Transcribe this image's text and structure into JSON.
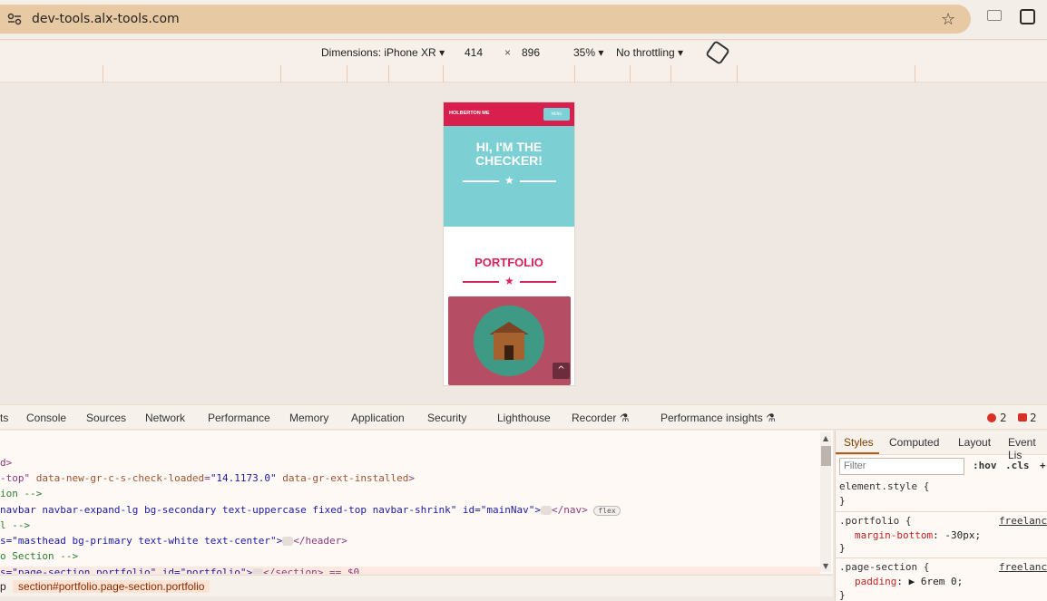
{
  "browser": {
    "url": "dev-tools.alx-tools.com"
  },
  "device_toolbar": {
    "dimensions_label": "Dimensions: iPhone XR",
    "width": "414",
    "times": "×",
    "height": "896",
    "zoom": "35%",
    "throttle": "No throttling"
  },
  "preview": {
    "brand": "HOLBERTON ME",
    "menu_label": "MENU",
    "heading": "HI, I'M THE CHECKER!",
    "portfolio_title": "PORTFOLIO",
    "scroll_up": "^"
  },
  "devtools": {
    "tabs": [
      "ts",
      "Console",
      "Sources",
      "Network",
      "Performance",
      "Memory",
      "Application",
      "Security",
      "Lighthouse",
      "Recorder",
      "Performance insights"
    ],
    "error_count": "2",
    "issue_count": "2",
    "code_lines": [
      {
        "tag": "d>"
      },
      {
        "pre": "-top\" ",
        "attr1": "data-new-gr-c-s-check-loaded",
        "val1": "\"14.1173.0\"",
        "attr2": " data-gr-ext-installed",
        "post": ">"
      },
      {
        "comment": "ion -->"
      },
      {
        "text": "navbar navbar-expand-lg bg-secondary text-uppercase fixed-top navbar-shrink\" id=\"mainNav\">",
        "end": "</nav>",
        "badge": "flex"
      },
      {
        "comment": "l -->"
      },
      {
        "text": "s=\"masthead bg-primary text-white text-center\">",
        "end": "</header>"
      },
      {
        "comment": "o Section -->"
      },
      {
        "text": "s=\"page-section portfolio\" id=\"portfolio\">",
        "end": "</section> == $0"
      }
    ],
    "breadcrumb": [
      "p",
      "section#portfolio.page-section.portfolio"
    ],
    "styles_tabs": [
      "Styles",
      "Computed",
      "Layout",
      "Event Lis"
    ],
    "filter_placeholder": "Filter",
    "hov": ":hov",
    "cls": ".cls",
    "plus": "+",
    "rules": [
      {
        "selector": "element.style {",
        "close": "}"
      },
      {
        "selector": ".portfolio {",
        "prop": "margin-bottom",
        "value": "-30px;",
        "source": "freelance",
        "close": "}"
      },
      {
        "selector": ".page-section {",
        "prop": "padding",
        "value": "6rem 0;",
        "source": "freelance",
        "close": "}"
      }
    ]
  }
}
